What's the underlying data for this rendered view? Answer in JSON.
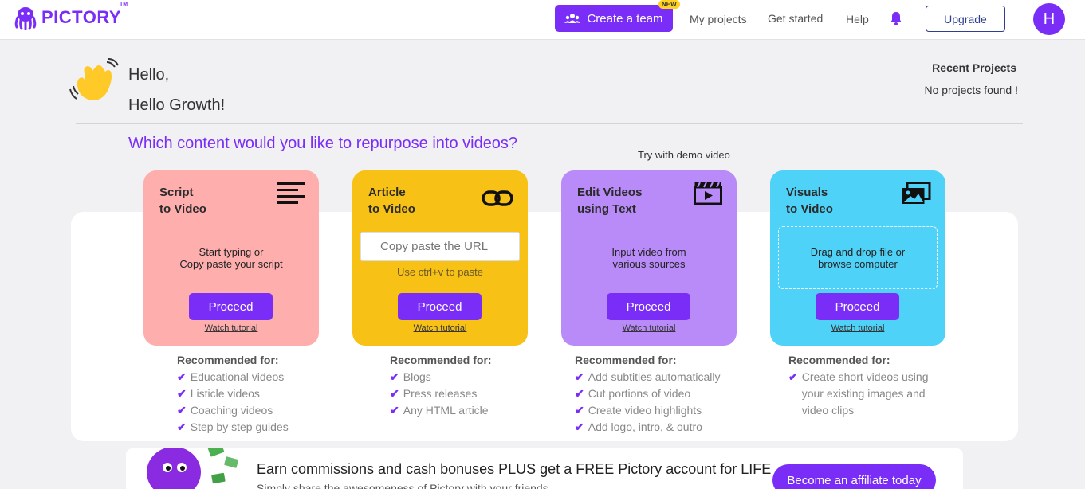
{
  "brand": {
    "name": "PICTORY",
    "tm": "TM"
  },
  "nav": {
    "create_team": "Create a team",
    "new_badge": "NEW",
    "my_projects": "My projects",
    "get_started": "Get started",
    "help": "Help",
    "upgrade": "Upgrade",
    "avatar_initial": "H"
  },
  "greeting": {
    "line1": "Hello,",
    "line2": "Hello Growth!"
  },
  "recent": {
    "title": "Recent Projects",
    "empty": "No projects found !"
  },
  "question": "Which content would you like to repurpose into videos?",
  "demo_link": "Try with demo video",
  "cards": [
    {
      "title": "Script\nto Video",
      "icon": "text-lines-icon",
      "color": "#ffaeae",
      "description": "Start typing or\nCopy paste your script",
      "proceed": "Proceed",
      "tutorial": "Watch tutorial"
    },
    {
      "title": "Article\nto Video",
      "icon": "link-icon",
      "color": "#f8c116",
      "url_placeholder": "Copy paste the URL",
      "hint": "Use ctrl+v to paste",
      "proceed": "Proceed",
      "tutorial": "Watch tutorial"
    },
    {
      "title": "Edit Videos\nusing Text",
      "icon": "video-clapper-icon",
      "color": "#b98bf8",
      "description": "Input video from\nvarious sources",
      "proceed": "Proceed",
      "tutorial": "Watch tutorial"
    },
    {
      "title": "Visuals\nto Video",
      "icon": "images-icon",
      "color": "#4fd2f8",
      "description": "Drag and drop file or\nbrowse computer",
      "proceed": "Proceed",
      "tutorial": "Watch tutorial"
    }
  ],
  "recommended": {
    "title": "Recommended for:",
    "lists": [
      [
        "Educational videos",
        "Listicle videos",
        "Coaching videos",
        "Step by step guides"
      ],
      [
        "Blogs",
        "Press releases",
        "Any HTML article"
      ],
      [
        "Add subtitles automatically",
        "Cut portions of video",
        "Create video highlights",
        "Add logo, intro, & outro"
      ],
      [
        "Create short videos using your existing images and video clips"
      ]
    ]
  },
  "banner": {
    "text": "Earn commissions and cash bonuses PLUS get a FREE Pictory account for LIFE",
    "subtext": "Simply share the awesomeness of Pictory with your friends",
    "button": "Become an affiliate today"
  },
  "colors": {
    "accent": "#7a2df6",
    "background": "#f1f1f3"
  }
}
